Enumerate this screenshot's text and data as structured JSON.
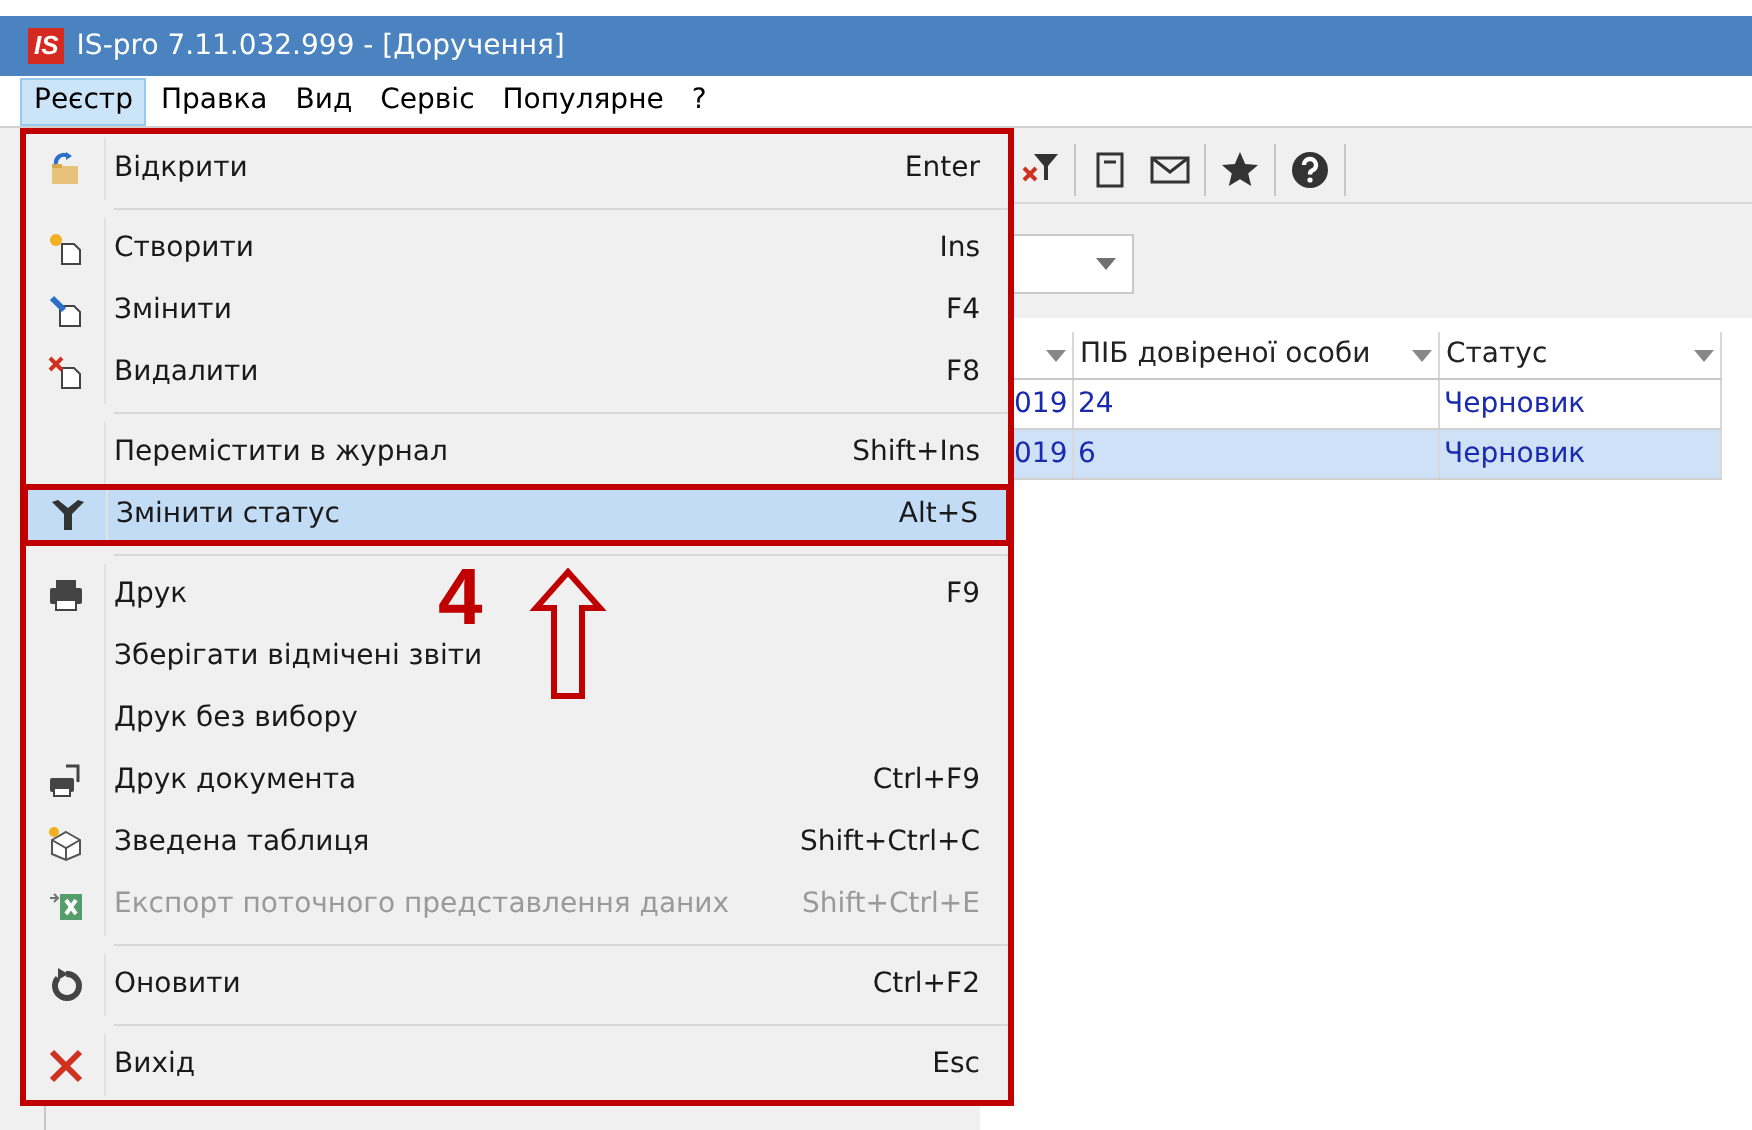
{
  "window": {
    "logo": "IS",
    "title": "IS-pro 7.11.032.999 - [Доручення]"
  },
  "menubar": [
    {
      "label": "Реєстр",
      "selected": true
    },
    {
      "label": "Правка",
      "selected": false
    },
    {
      "label": "Вид",
      "selected": false
    },
    {
      "label": "Сервіс",
      "selected": false
    },
    {
      "label": "Популярне",
      "selected": false
    },
    {
      "label": "?",
      "selected": false
    }
  ],
  "menu": [
    {
      "kind": "item",
      "label": "Відкрити",
      "shortcut": "Enter",
      "selected": false,
      "disabled": false
    },
    {
      "kind": "separator"
    },
    {
      "kind": "item",
      "label": "Створити",
      "shortcut": "Ins",
      "selected": false,
      "disabled": false
    },
    {
      "kind": "item",
      "label": "Змінити",
      "shortcut": "F4",
      "selected": false,
      "disabled": false
    },
    {
      "kind": "item",
      "label": "Видалити",
      "shortcut": "F8",
      "selected": false,
      "disabled": false
    },
    {
      "kind": "separator"
    },
    {
      "kind": "item",
      "label": "Перемістити в журнал",
      "shortcut": "Shift+Ins",
      "selected": false,
      "disabled": false
    },
    {
      "kind": "item",
      "label": "Змінити статус",
      "shortcut": "Alt+S",
      "selected": true,
      "disabled": false,
      "framed": true
    },
    {
      "kind": "separator"
    },
    {
      "kind": "item",
      "label": "Друк",
      "shortcut": "F9",
      "selected": false,
      "disabled": false
    },
    {
      "kind": "item",
      "label": "Зберігати відмічені звіти",
      "selected": false,
      "disabled": false
    },
    {
      "kind": "item",
      "label": "Друк без вибору",
      "selected": false,
      "disabled": false
    },
    {
      "kind": "item",
      "label": "Друк документа",
      "shortcut": "Ctrl+F9",
      "selected": false,
      "disabled": false
    },
    {
      "kind": "item",
      "label": "Зведена таблиця",
      "shortcut": "Shift+Ctrl+C",
      "selected": false,
      "disabled": false
    },
    {
      "kind": "item",
      "label": "Експорт поточного представлення даних",
      "shortcut": "Shift+Ctrl+E",
      "selected": false,
      "disabled": true
    },
    {
      "kind": "separator"
    },
    {
      "kind": "item",
      "label": "Оновити",
      "shortcut": "Ctrl+F2",
      "selected": false,
      "disabled": false
    },
    {
      "kind": "separator"
    },
    {
      "kind": "item",
      "label": "Вихід",
      "shortcut": "Esc",
      "selected": false,
      "disabled": false
    }
  ],
  "annotation": {
    "step": "4"
  },
  "table": {
    "columns": [
      {},
      {
        "label": "ПІБ довіреної особи"
      },
      {
        "label": "Статус"
      }
    ],
    "rows": [
      {
        "cells": [
          "019",
          "24",
          "Черновик"
        ],
        "selected": false
      },
      {
        "cells": [
          "019",
          "6",
          "Черновик"
        ],
        "selected": true
      }
    ]
  }
}
